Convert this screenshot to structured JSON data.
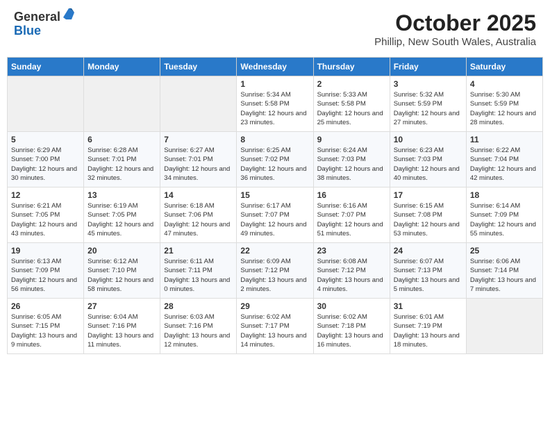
{
  "header": {
    "logo": {
      "general": "General",
      "blue": "Blue"
    },
    "title": "October 2025",
    "location": "Phillip, New South Wales, Australia"
  },
  "calendar": {
    "days_of_week": [
      "Sunday",
      "Monday",
      "Tuesday",
      "Wednesday",
      "Thursday",
      "Friday",
      "Saturday"
    ],
    "weeks": [
      [
        {
          "day": "",
          "info": ""
        },
        {
          "day": "",
          "info": ""
        },
        {
          "day": "",
          "info": ""
        },
        {
          "day": "1",
          "info": "Sunrise: 5:34 AM\nSunset: 5:58 PM\nDaylight: 12 hours and 23 minutes."
        },
        {
          "day": "2",
          "info": "Sunrise: 5:33 AM\nSunset: 5:58 PM\nDaylight: 12 hours and 25 minutes."
        },
        {
          "day": "3",
          "info": "Sunrise: 5:32 AM\nSunset: 5:59 PM\nDaylight: 12 hours and 27 minutes."
        },
        {
          "day": "4",
          "info": "Sunrise: 5:30 AM\nSunset: 5:59 PM\nDaylight: 12 hours and 28 minutes."
        }
      ],
      [
        {
          "day": "5",
          "info": "Sunrise: 6:29 AM\nSunset: 7:00 PM\nDaylight: 12 hours and 30 minutes."
        },
        {
          "day": "6",
          "info": "Sunrise: 6:28 AM\nSunset: 7:01 PM\nDaylight: 12 hours and 32 minutes."
        },
        {
          "day": "7",
          "info": "Sunrise: 6:27 AM\nSunset: 7:01 PM\nDaylight: 12 hours and 34 minutes."
        },
        {
          "day": "8",
          "info": "Sunrise: 6:25 AM\nSunset: 7:02 PM\nDaylight: 12 hours and 36 minutes."
        },
        {
          "day": "9",
          "info": "Sunrise: 6:24 AM\nSunset: 7:03 PM\nDaylight: 12 hours and 38 minutes."
        },
        {
          "day": "10",
          "info": "Sunrise: 6:23 AM\nSunset: 7:03 PM\nDaylight: 12 hours and 40 minutes."
        },
        {
          "day": "11",
          "info": "Sunrise: 6:22 AM\nSunset: 7:04 PM\nDaylight: 12 hours and 42 minutes."
        }
      ],
      [
        {
          "day": "12",
          "info": "Sunrise: 6:21 AM\nSunset: 7:05 PM\nDaylight: 12 hours and 43 minutes."
        },
        {
          "day": "13",
          "info": "Sunrise: 6:19 AM\nSunset: 7:05 PM\nDaylight: 12 hours and 45 minutes."
        },
        {
          "day": "14",
          "info": "Sunrise: 6:18 AM\nSunset: 7:06 PM\nDaylight: 12 hours and 47 minutes."
        },
        {
          "day": "15",
          "info": "Sunrise: 6:17 AM\nSunset: 7:07 PM\nDaylight: 12 hours and 49 minutes."
        },
        {
          "day": "16",
          "info": "Sunrise: 6:16 AM\nSunset: 7:07 PM\nDaylight: 12 hours and 51 minutes."
        },
        {
          "day": "17",
          "info": "Sunrise: 6:15 AM\nSunset: 7:08 PM\nDaylight: 12 hours and 53 minutes."
        },
        {
          "day": "18",
          "info": "Sunrise: 6:14 AM\nSunset: 7:09 PM\nDaylight: 12 hours and 55 minutes."
        }
      ],
      [
        {
          "day": "19",
          "info": "Sunrise: 6:13 AM\nSunset: 7:09 PM\nDaylight: 12 hours and 56 minutes."
        },
        {
          "day": "20",
          "info": "Sunrise: 6:12 AM\nSunset: 7:10 PM\nDaylight: 12 hours and 58 minutes."
        },
        {
          "day": "21",
          "info": "Sunrise: 6:11 AM\nSunset: 7:11 PM\nDaylight: 13 hours and 0 minutes."
        },
        {
          "day": "22",
          "info": "Sunrise: 6:09 AM\nSunset: 7:12 PM\nDaylight: 13 hours and 2 minutes."
        },
        {
          "day": "23",
          "info": "Sunrise: 6:08 AM\nSunset: 7:12 PM\nDaylight: 13 hours and 4 minutes."
        },
        {
          "day": "24",
          "info": "Sunrise: 6:07 AM\nSunset: 7:13 PM\nDaylight: 13 hours and 5 minutes."
        },
        {
          "day": "25",
          "info": "Sunrise: 6:06 AM\nSunset: 7:14 PM\nDaylight: 13 hours and 7 minutes."
        }
      ],
      [
        {
          "day": "26",
          "info": "Sunrise: 6:05 AM\nSunset: 7:15 PM\nDaylight: 13 hours and 9 minutes."
        },
        {
          "day": "27",
          "info": "Sunrise: 6:04 AM\nSunset: 7:16 PM\nDaylight: 13 hours and 11 minutes."
        },
        {
          "day": "28",
          "info": "Sunrise: 6:03 AM\nSunset: 7:16 PM\nDaylight: 13 hours and 12 minutes."
        },
        {
          "day": "29",
          "info": "Sunrise: 6:02 AM\nSunset: 7:17 PM\nDaylight: 13 hours and 14 minutes."
        },
        {
          "day": "30",
          "info": "Sunrise: 6:02 AM\nSunset: 7:18 PM\nDaylight: 13 hours and 16 minutes."
        },
        {
          "day": "31",
          "info": "Sunrise: 6:01 AM\nSunset: 7:19 PM\nDaylight: 13 hours and 18 minutes."
        },
        {
          "day": "",
          "info": ""
        }
      ]
    ]
  }
}
